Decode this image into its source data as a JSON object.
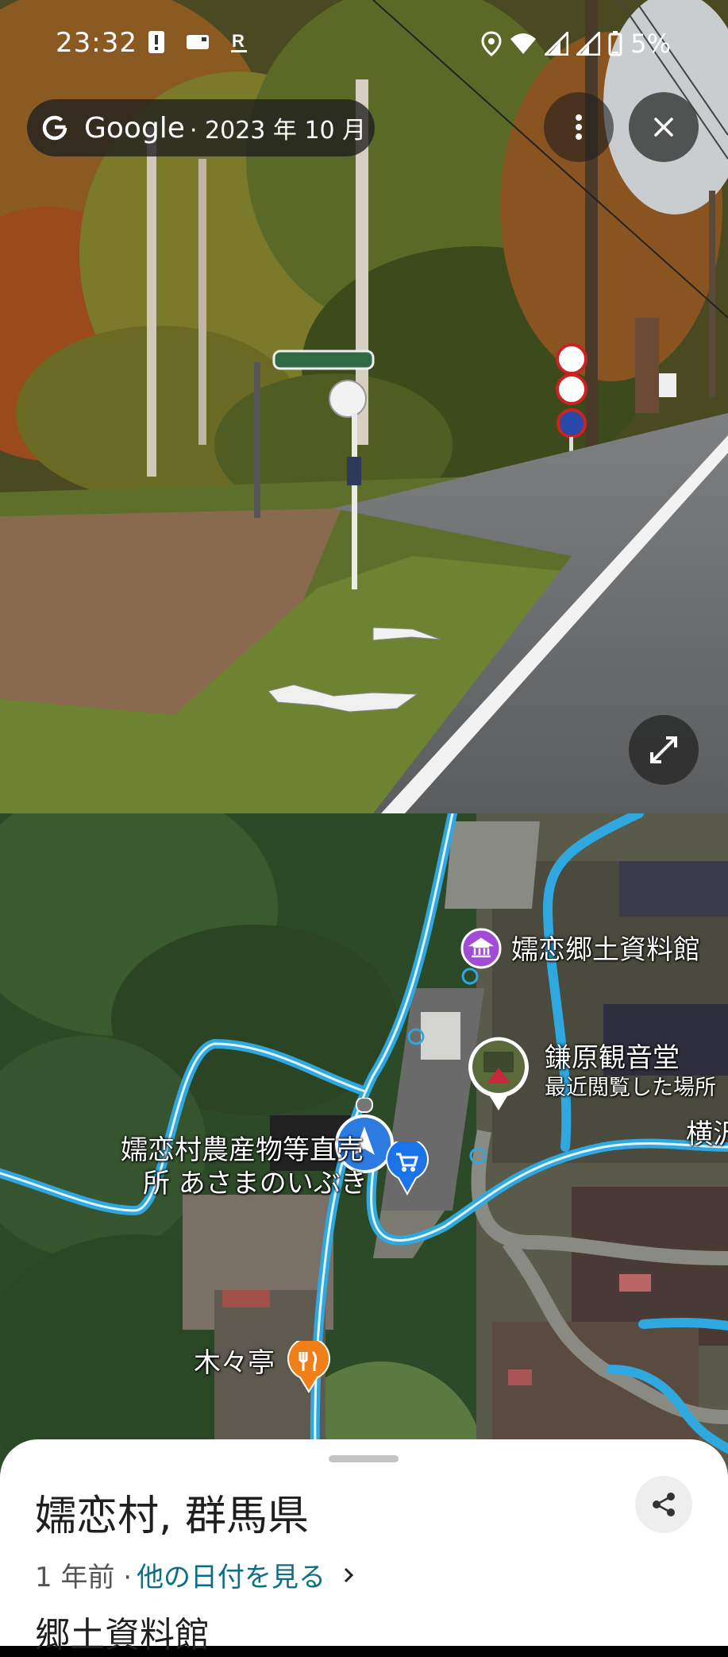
{
  "status_bar": {
    "time": "23:32",
    "battery": "5%",
    "icons_left": [
      "alert-icon",
      "card-icon",
      "rakuten-r-icon"
    ],
    "icons_right": [
      "location-icon",
      "wifi-icon",
      "signal-icon",
      "signal-icon",
      "battery-icon"
    ]
  },
  "street_view": {
    "brand": "Google",
    "date": "· 2023 年 10 月",
    "more_icon": "more-vert-icon",
    "close_icon": "close-icon",
    "expand_icon": "expand-icon"
  },
  "map": {
    "labels": {
      "museum": "嬬恋郷土資料館",
      "kannon": "鎌原観音堂",
      "kannon_sub": "最近閲覧した場所",
      "market_line1": "嬬恋村農産物等直売",
      "market_line2": "所 あさまのいぶき",
      "restaurant": "木々亭",
      "edge": "横沢"
    },
    "colors": {
      "road": "#2fa8e0",
      "museum_pin": "#a24bd6",
      "food_pin": "#f07f1a",
      "shop_pin": "#1a73e8",
      "nav_arrow": "#2d7be0"
    }
  },
  "sheet": {
    "title": "嬬恋村, 群馬県",
    "time_ago": "1 年前 ·",
    "other_dates": "他の日付を見る",
    "next_line": "郷土資料館"
  }
}
